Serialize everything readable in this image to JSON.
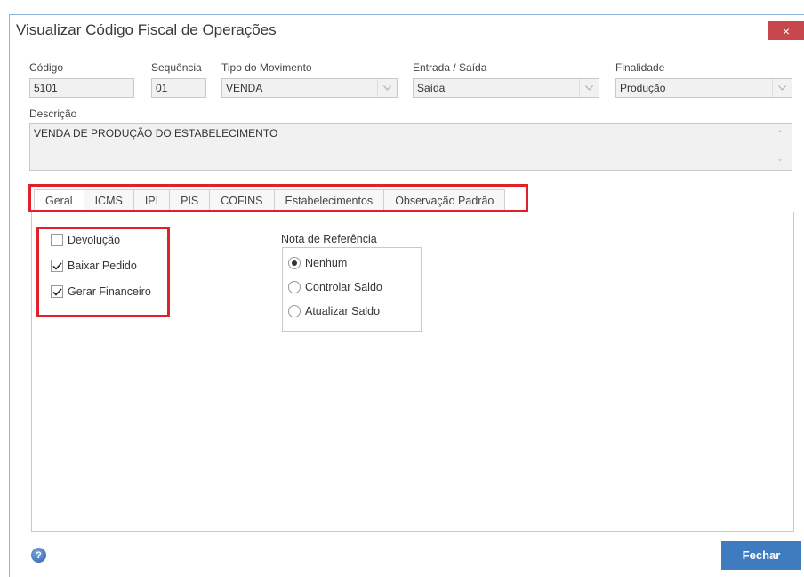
{
  "window": {
    "title": "Visualizar Código Fiscal de Operações",
    "close_glyph": "×"
  },
  "fields": {
    "codigo": {
      "label": "Código",
      "value": "5101"
    },
    "sequencia": {
      "label": "Sequência",
      "value": "01"
    },
    "tipo_movimento": {
      "label": "Tipo do Movimento",
      "value": "VENDA"
    },
    "entrada_saida": {
      "label": "Entrada / Saída",
      "value": "Saída"
    },
    "finalidade": {
      "label": "Finalidade",
      "value": "Produção"
    },
    "descricao": {
      "label": "Descrição",
      "value": "VENDA DE PRODUÇÃO DO ESTABELECIMENTO"
    }
  },
  "tabs": [
    {
      "label": "Geral"
    },
    {
      "label": "ICMS"
    },
    {
      "label": "IPI"
    },
    {
      "label": "PIS"
    },
    {
      "label": "COFINS"
    },
    {
      "label": "Estabelecimentos"
    },
    {
      "label": "Observação Padrão"
    }
  ],
  "checkboxes": [
    {
      "label": "Devolução",
      "checked": false
    },
    {
      "label": "Baixar Pedido",
      "checked": true
    },
    {
      "label": "Gerar Financeiro",
      "checked": true
    }
  ],
  "nota_referencia": {
    "title": "Nota de Referência",
    "options": [
      {
        "label": "Nenhum",
        "selected": true
      },
      {
        "label": "Controlar Saldo",
        "selected": false
      },
      {
        "label": "Atualizar Saldo",
        "selected": false
      }
    ]
  },
  "footer": {
    "help_glyph": "?",
    "close_label": "Fechar"
  },
  "colors": {
    "highlight": "#e0202b",
    "primary_button": "#3f7cbf",
    "close_button": "#c7474d"
  }
}
